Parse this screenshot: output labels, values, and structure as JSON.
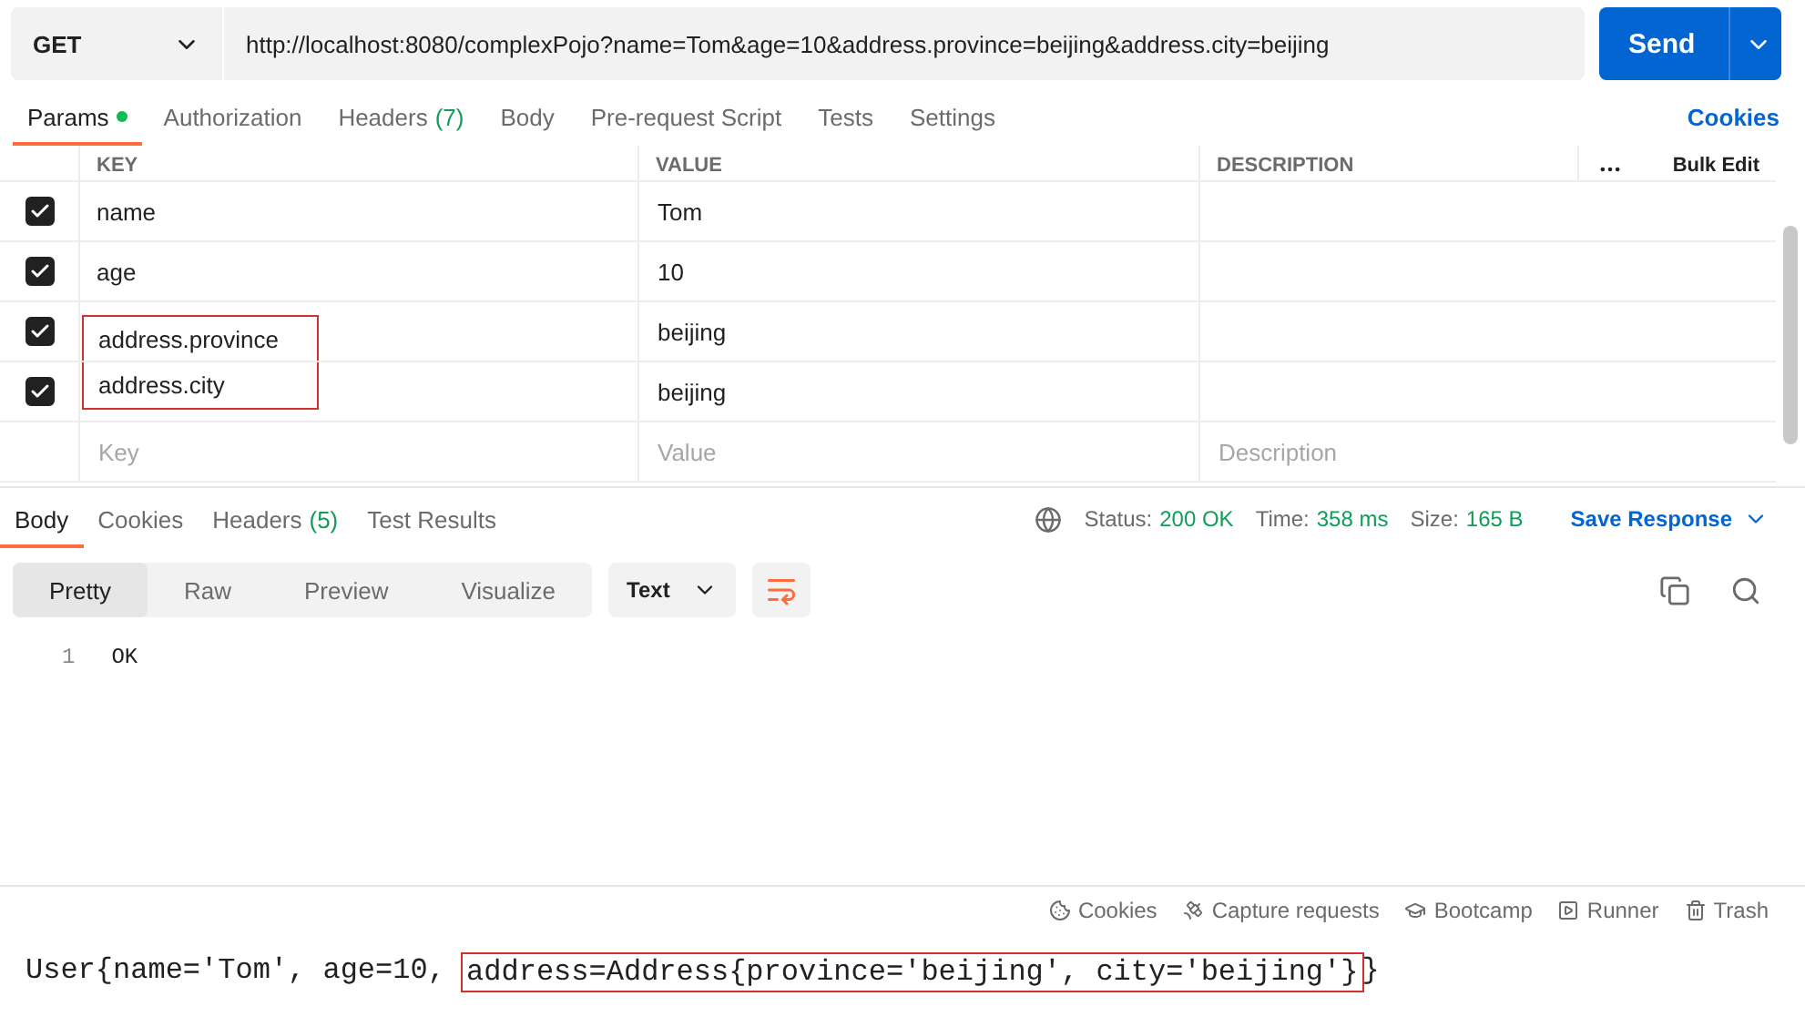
{
  "request": {
    "method": "GET",
    "url": "http://localhost:8080/complexPojo?name=Tom&age=10&address.province=beijing&address.city=beijing",
    "send": "Send"
  },
  "request_tabs": [
    {
      "label": "Params",
      "selected": true,
      "indicator": true
    },
    {
      "label": "Authorization",
      "selected": false,
      "indicator": false
    },
    {
      "label": "Headers",
      "count": "(7)",
      "selected": false,
      "indicator": false
    },
    {
      "label": "Body",
      "selected": false,
      "indicator": false
    },
    {
      "label": "Pre-request Script",
      "selected": false,
      "indicator": false
    },
    {
      "label": "Tests",
      "selected": false,
      "indicator": false
    },
    {
      "label": "Settings",
      "selected": false,
      "indicator": false
    }
  ],
  "cookies_link": "Cookies",
  "params_table": {
    "columns": [
      "KEY",
      "VALUE",
      "DESCRIPTION"
    ],
    "bulk_edit": "Bulk Edit",
    "rows": [
      {
        "checked": true,
        "key": "name",
        "value": "Tom",
        "highlighted": false
      },
      {
        "checked": true,
        "key": "age",
        "value": "10",
        "highlighted": false
      },
      {
        "checked": true,
        "key": "address.province",
        "value": "beijing",
        "highlighted": true
      },
      {
        "checked": true,
        "key": "address.city",
        "value": "beijing",
        "highlighted": true
      }
    ],
    "new_row": [
      {
        "placeholder": "Key"
      },
      {
        "placeholder": "Value"
      },
      {
        "placeholder": "Description"
      }
    ]
  },
  "response_tabs": [
    {
      "label": "Body",
      "selected": true
    },
    {
      "label": "Cookies",
      "selected": false
    },
    {
      "label": "Headers",
      "count": "(5)",
      "selected": false
    },
    {
      "label": "Test Results",
      "selected": false
    }
  ],
  "response_meta": {
    "status_label": "Status:",
    "status": "200 OK",
    "time_label": "Time:",
    "time": "358 ms",
    "size_label": "Size:",
    "size": "165 B",
    "save": "Save Response"
  },
  "view_modes": [
    {
      "label": "Pretty",
      "selected": true
    },
    {
      "label": "Raw",
      "selected": false
    },
    {
      "label": "Preview",
      "selected": false
    },
    {
      "label": "Visualize",
      "selected": false
    }
  ],
  "format": "Text",
  "body_lines": [
    {
      "number": "1",
      "text": "OK"
    }
  ],
  "status_bar": [
    {
      "kind": "cookies",
      "label": "Cookies"
    },
    {
      "kind": "capture",
      "label": "Capture requests"
    },
    {
      "kind": "bootcamp",
      "label": "Bootcamp"
    },
    {
      "kind": "runner",
      "label": "Runner"
    },
    {
      "kind": "trash",
      "label": "Trash"
    }
  ],
  "console": [
    {
      "text": "User{name='Tom', age=10, ",
      "highlighted": false
    },
    {
      "text": "address=Address{province='beijing', city='beijing'}",
      "highlighted": true
    },
    {
      "text": "}",
      "highlighted": false
    }
  ]
}
